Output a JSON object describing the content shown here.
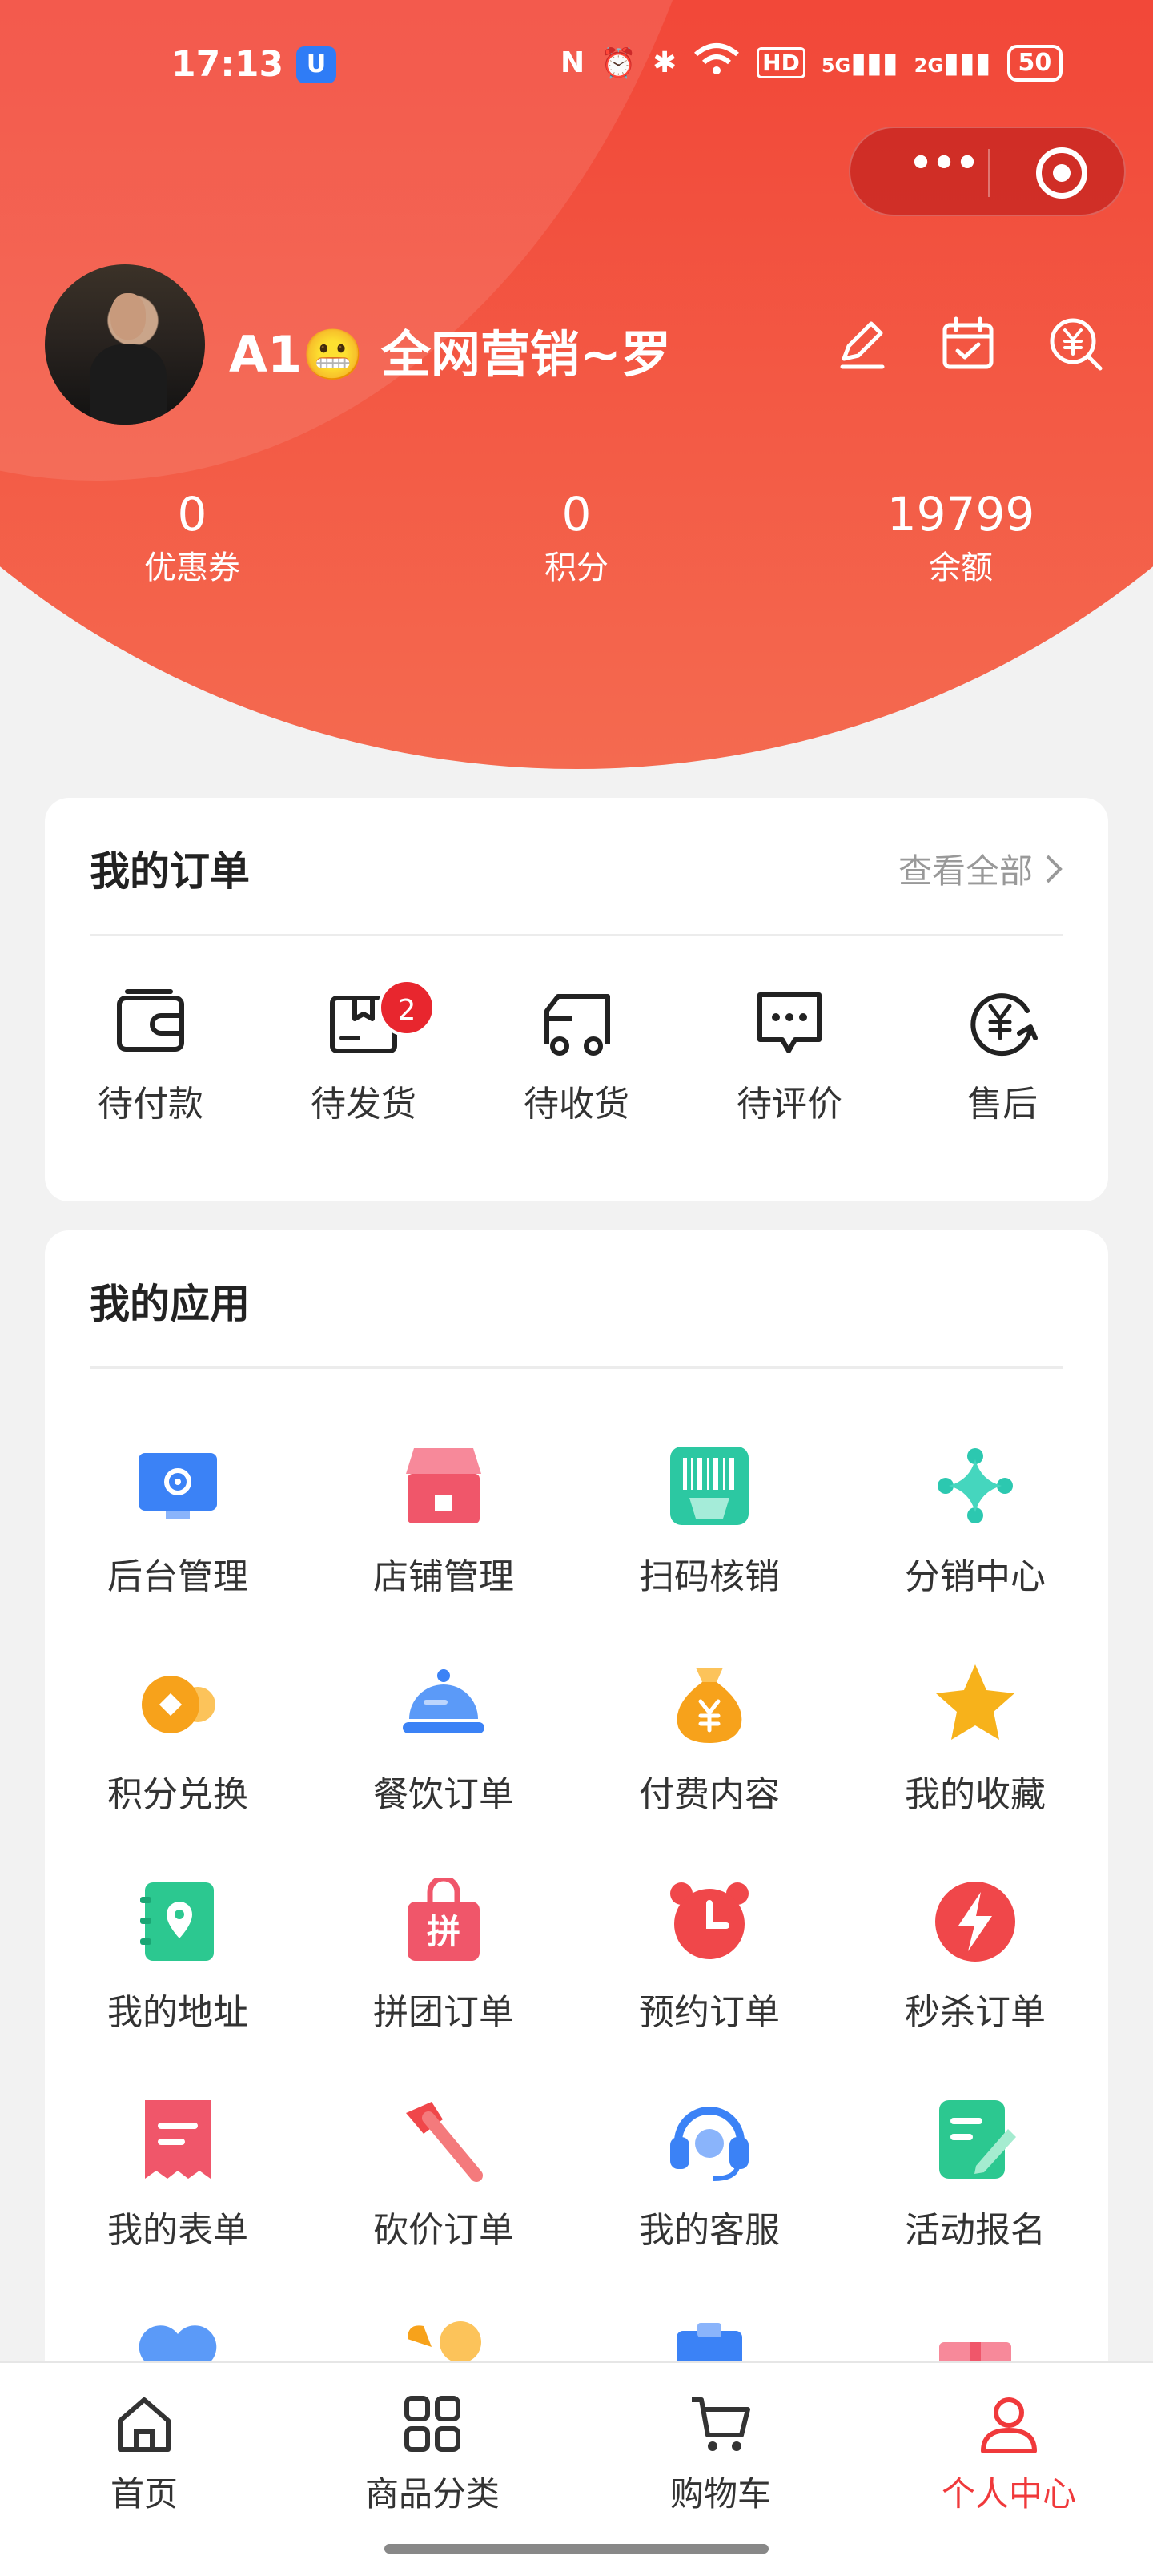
{
  "status_bar": {
    "time": "17:13",
    "app_badge": "U",
    "network": "5G",
    "network2": "2G",
    "battery": "50"
  },
  "profile": {
    "username": "A1😬 全网营销~罗"
  },
  "stats": [
    {
      "value": "0",
      "label": "优惠券"
    },
    {
      "value": "0",
      "label": "积分"
    },
    {
      "value": "19799",
      "label": "余额"
    }
  ],
  "orders": {
    "title": "我的订单",
    "view_all": "查看全部",
    "items": [
      {
        "label": "待付款",
        "icon": "wallet-icon"
      },
      {
        "label": "待发货",
        "icon": "package-icon",
        "badge": "2"
      },
      {
        "label": "待收货",
        "icon": "truck-icon"
      },
      {
        "label": "待评价",
        "icon": "comment-icon"
      },
      {
        "label": "售后",
        "icon": "yen-refund-icon"
      }
    ]
  },
  "apps": {
    "title": "我的应用",
    "items": [
      {
        "label": "后台管理",
        "icon": "monitor-gear-icon",
        "color": "#3b82f6"
      },
      {
        "label": "店铺管理",
        "icon": "shop-icon",
        "color": "#f0566a"
      },
      {
        "label": "扫码核销",
        "icon": "scan-icon",
        "color": "#2cc8a2"
      },
      {
        "label": "分销中心",
        "icon": "sparkle-network-icon",
        "color": "#2cc8b0"
      },
      {
        "label": "积分兑换",
        "icon": "coin-exchange-icon",
        "color": "#f7a21b"
      },
      {
        "label": "餐饮订单",
        "icon": "food-cloche-icon",
        "color": "#3b82f6"
      },
      {
        "label": "付费内容",
        "icon": "money-bag-icon",
        "color": "#f7a21b"
      },
      {
        "label": "我的收藏",
        "icon": "star-icon",
        "color": "#f7b21b"
      },
      {
        "label": "我的地址",
        "icon": "address-book-icon",
        "color": "#2cc890"
      },
      {
        "label": "拼团订单",
        "icon": "group-buy-bag-icon",
        "color": "#f0566a",
        "glyph": "拼"
      },
      {
        "label": "预约订单",
        "icon": "alarm-clock-icon",
        "color": "#f0474a"
      },
      {
        "label": "秒杀订单",
        "icon": "flash-sale-icon",
        "color": "#f0474a"
      },
      {
        "label": "我的表单",
        "icon": "form-icon",
        "color": "#f0566a"
      },
      {
        "label": "砍价订单",
        "icon": "axe-icon",
        "color": "#f0474a"
      },
      {
        "label": "我的客服",
        "icon": "headset-icon",
        "color": "#3b82f6"
      },
      {
        "label": "活动报名",
        "icon": "sign-up-edit-icon",
        "color": "#2cc890"
      }
    ],
    "partial_row_icons": [
      "heart-icon",
      "phone-chat-icon",
      "clipboard-icon",
      "gift-icon"
    ]
  },
  "tabbar": {
    "items": [
      {
        "label": "首页",
        "icon": "home-icon"
      },
      {
        "label": "商品分类",
        "icon": "grid-icon"
      },
      {
        "label": "购物车",
        "icon": "cart-icon"
      },
      {
        "label": "个人中心",
        "icon": "user-icon",
        "active": true
      }
    ],
    "active_color": "#f0393b"
  }
}
